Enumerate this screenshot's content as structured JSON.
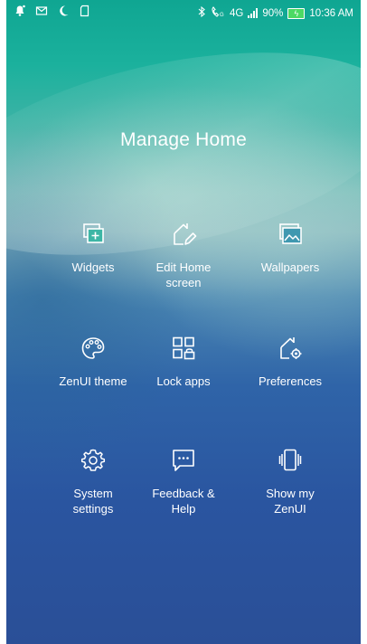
{
  "status_bar": {
    "network": "4G",
    "battery": "90%",
    "time": "10:36 AM",
    "left_icons": [
      "notification-icon",
      "message-icon",
      "moon-icon",
      "sd-card-icon"
    ],
    "right_icons": [
      "bluetooth-icon",
      "call-icon",
      "signal-icon",
      "battery-icon"
    ]
  },
  "title": "Manage Home",
  "tiles": [
    {
      "label": "Widgets",
      "icon": "widgets-icon"
    },
    {
      "label": "Edit Home\nscreen",
      "icon": "edit-home-icon"
    },
    {
      "label": "Wallpapers",
      "icon": "wallpapers-icon"
    },
    {
      "label": "ZenUI theme",
      "icon": "palette-icon"
    },
    {
      "label": "Lock apps",
      "icon": "lock-apps-icon"
    },
    {
      "label": "Preferences",
      "icon": "preferences-icon"
    },
    {
      "label": "System\nsettings",
      "icon": "gear-icon"
    },
    {
      "label": "Feedback &\nHelp",
      "icon": "feedback-icon"
    },
    {
      "label": "Show my\nZenUI",
      "icon": "phone-shake-icon"
    }
  ],
  "colors": {
    "top": "#0fa692",
    "bottom": "#2a4f97",
    "battery": "#4cd964",
    "text": "#ffffff"
  }
}
